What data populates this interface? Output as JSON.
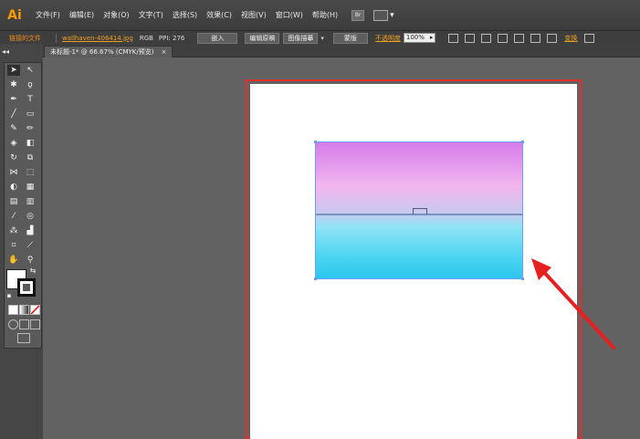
{
  "app": {
    "logo": "Ai",
    "accent": "#ff9a00"
  },
  "menu": {
    "items": [
      "文件(F)",
      "编辑(E)",
      "对象(O)",
      "文字(T)",
      "选择(S)",
      "效果(C)",
      "视图(V)",
      "窗口(W)",
      "帮助(H)"
    ],
    "bridge_label": "Br"
  },
  "control_bar": {
    "linked_file": "链接的文件",
    "filename": "wallhaven-406414.jpg",
    "color_mode": "RGB",
    "ppi": "PPI: 276",
    "embed_button": "嵌入",
    "edit_original_button": "编辑原稿",
    "image_trace_button": "图像描摹",
    "mask_button": "蒙版",
    "opacity_label": "不透明度",
    "opacity_value": "100%",
    "transform_label": "变换"
  },
  "document_tab": {
    "title": "未标题-1* @ 66.67% (CMYK/预览)",
    "close": "×"
  },
  "panel_collapse": "◂◂",
  "colors": {
    "artboard_border": "#e0302a",
    "annotation_arrow": "#e62020"
  }
}
